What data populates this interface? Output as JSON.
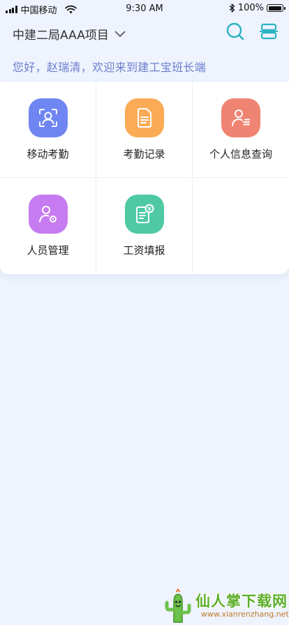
{
  "status_bar": {
    "carrier": "中国移动",
    "time": "9:30 AM",
    "battery_percent": "100%",
    "battery_level": 1.0
  },
  "header": {
    "project_title": "中建二局AAA项目",
    "dropdown_icon": "chevron-down-icon",
    "search_icon": "search-icon",
    "scan_icon": "scan-icon"
  },
  "greeting": "您好，赵瑞清，欢迎来到建工宝班长端",
  "menu": [
    {
      "label": "移动考勤",
      "icon": "face-scan-icon",
      "color": "#6f86f2"
    },
    {
      "label": "考勤记录",
      "icon": "document-icon",
      "color": "#fbab56"
    },
    {
      "label": "个人信息查询",
      "icon": "person-list-icon",
      "color": "#ee8471"
    },
    {
      "label": "人员管理",
      "icon": "person-settings-icon",
      "color": "#c77bf0"
    },
    {
      "label": "工资填报",
      "icon": "salary-form-icon",
      "color": "#4ec9a4"
    }
  ],
  "watermark": {
    "text": "仙人掌下载网",
    "url": "www.xianrenzhang.net"
  },
  "colors": {
    "background": "#eef3fd",
    "greeting": "#6b7fcf",
    "header_accent": "#2ab3c4"
  }
}
